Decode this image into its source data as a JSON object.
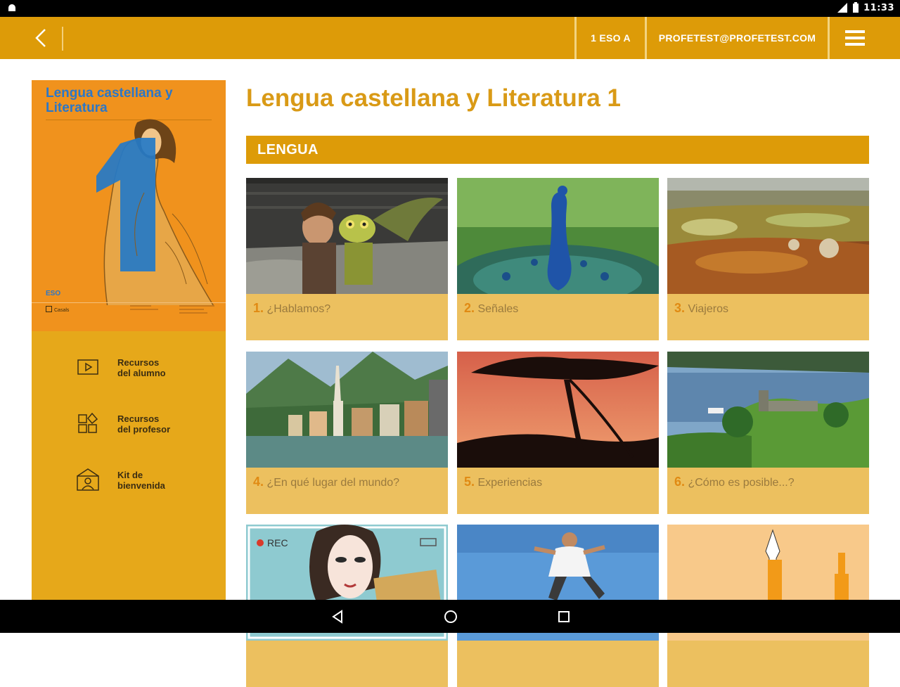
{
  "status_bar": {
    "time": "11:33",
    "icons": [
      "android-icon",
      "signal-icon",
      "battery-icon"
    ]
  },
  "header": {
    "class_label": "1 ESO A",
    "user_email": "PROFETEST@PROFETEST.COM",
    "icons": [
      "back-icon",
      "menu-icon"
    ],
    "color": "#dd9b08"
  },
  "sidebar": {
    "cover": {
      "title": "Lengua castellana y Literatura",
      "big_number": "1",
      "level": "ESO",
      "publisher": "Casals"
    },
    "items": [
      {
        "label": "Recursos\ndel alumno",
        "icon": "play-screen-icon"
      },
      {
        "label": "Recursos\ndel profesor",
        "icon": "shapes-icon"
      },
      {
        "label": "Kit de\nbienvenida",
        "icon": "welcome-kit-icon"
      }
    ]
  },
  "main": {
    "title": "Lengua castellana y Literatura 1",
    "section": "LENGUA",
    "units": [
      {
        "num": "1.",
        "title": " ¿Hablamos?"
      },
      {
        "num": "2.",
        "title": " Señales"
      },
      {
        "num": "3.",
        "title": " Viajeros"
      },
      {
        "num": "4.",
        "title": " ¿En qué lugar del mundo?"
      },
      {
        "num": "5.",
        "title": " Experiencias"
      },
      {
        "num": "6.",
        "title": " ¿Cómo es posible...?"
      },
      {
        "num": "",
        "title": ""
      },
      {
        "num": "",
        "title": ""
      },
      {
        "num": "",
        "title": ""
      }
    ],
    "rec_label": "REC"
  },
  "colors": {
    "accent": "#dd9b08",
    "title": "#d99a16",
    "card": "#ecc05f",
    "cover": "#f0921d",
    "cover_title": "#2b77c8"
  }
}
